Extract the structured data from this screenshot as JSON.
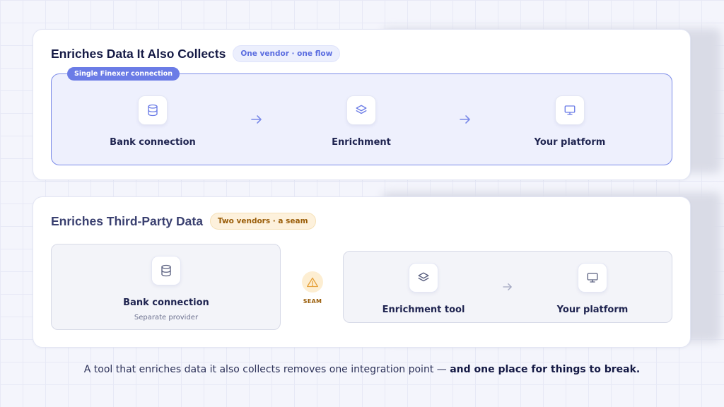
{
  "colors": {
    "accent": "#6b7ce6",
    "warning": "#e6a23c",
    "card_background": "#ffffff",
    "page_background": "#f4f5fc"
  },
  "integrated": {
    "title": "Enriches Data It Also Collects",
    "badge": "One vendor · one flow",
    "connection_tag": "Single Finexer connection",
    "steps": [
      {
        "icon": "database-icon",
        "label": "Bank connection"
      },
      {
        "icon": "layers-icon",
        "label": "Enrichment"
      },
      {
        "icon": "monitor-icon",
        "label": "Your platform"
      }
    ]
  },
  "third_party": {
    "title": "Enriches Third-Party Data",
    "badge": "Two vendors · a seam",
    "provider": {
      "icon": "database-icon",
      "label": "Bank connection",
      "sublabel": "Separate provider"
    },
    "seam_label": "SEAM",
    "steps": [
      {
        "icon": "layers-icon",
        "label": "Enrichment tool"
      },
      {
        "icon": "monitor-icon",
        "label": "Your platform"
      }
    ]
  },
  "footer": {
    "text": "A tool that enriches data it also collects removes one integration point — ",
    "emphasis": "and one place for things to break."
  }
}
